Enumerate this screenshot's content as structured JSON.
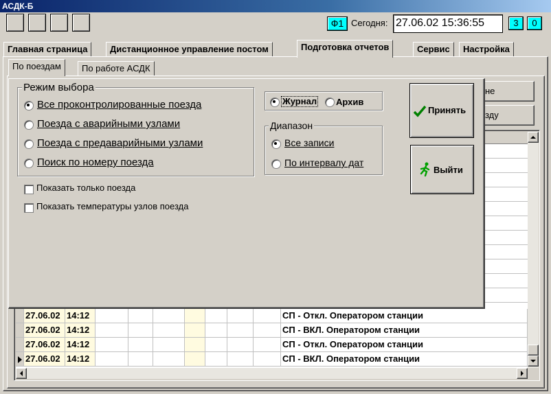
{
  "window": {
    "title": "АСДК-Б"
  },
  "header": {
    "f1_label": "Ф1",
    "today_label": "Сегодня:",
    "datetime": "27.06.02 15:36:55",
    "badge_3": "3",
    "badge_0": "0"
  },
  "tabs": [
    {
      "label": "Главная страница"
    },
    {
      "label": "Дистанционное управление постом"
    },
    {
      "label": "Подготовка отчетов"
    },
    {
      "label": "Сервис"
    },
    {
      "label": "Настройка"
    }
  ],
  "subtabs": [
    {
      "label": "По поездам"
    },
    {
      "label": "По работе АСДК"
    }
  ],
  "bg_buttons": {
    "btn1_tail": "не",
    "btn2_tail": "зду"
  },
  "table": {
    "rows": [
      {
        "date": "27.06.02",
        "time": "14:12",
        "event": "СП -  Откл. Оператором станции"
      },
      {
        "date": "27.06.02",
        "time": "14:12",
        "event": "СП -  ВКЛ.  Оператором станции"
      },
      {
        "date": "27.06.02",
        "time": "14:12",
        "event": "СП -  Откл. Оператором станции"
      },
      {
        "date": "27.06.02",
        "time": "14:12",
        "event": "СП -  ВКЛ.  Оператором станции"
      }
    ]
  },
  "dialog": {
    "mode_group": {
      "title": "Режим выбора",
      "options": [
        {
          "label": "Все проконтролированные поезда",
          "selected": true
        },
        {
          "label": "Поезда с аварийными узлами",
          "selected": false
        },
        {
          "label": "Поезда с предаварийными узлами",
          "selected": false
        },
        {
          "label": "Поиск по номеру поезда",
          "selected": false
        }
      ]
    },
    "source": {
      "journal": "Журнал",
      "archive": "Архив"
    },
    "range_group": {
      "title": "Диапазон",
      "all_records": "Все записи",
      "by_interval": "По интервалу дат"
    },
    "checks": {
      "only_trains": "Показать только поезда",
      "show_temps": "Показать температуры узлов поезда"
    },
    "accept_label": "Принять",
    "exit_label": "Выйти"
  },
  "colors": {
    "cyan": "#00ffff",
    "accept_check": "#008000",
    "exit_icon": "#00a000"
  }
}
